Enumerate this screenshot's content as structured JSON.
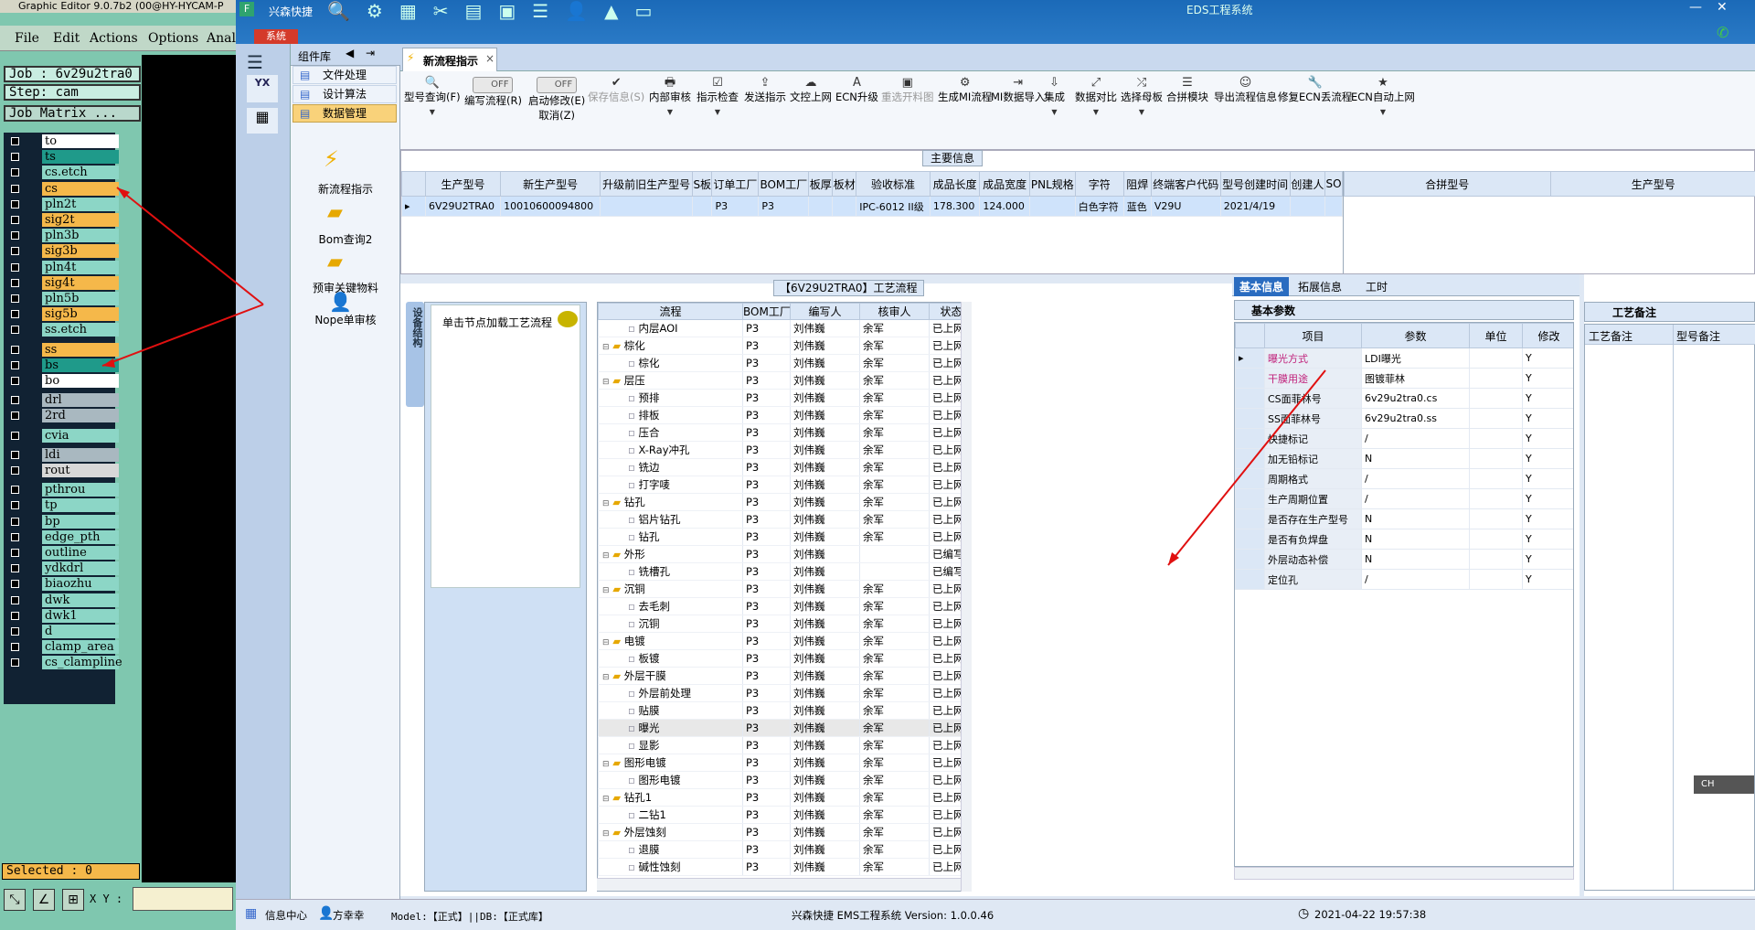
{
  "ge": {
    "title": "Graphic Editor 9.0.7b2 (00@HY-HYCAM-P",
    "menu": [
      "File",
      "Edit",
      "Actions",
      "Options",
      "Anal"
    ],
    "job": "Job : 6v29u2tra0",
    "step": "Step: cam",
    "matrix": "Job Matrix ...",
    "layers": [
      {
        "name": "to",
        "color": "#ffffff"
      },
      {
        "name": "ts",
        "color": "#1f9a8a"
      },
      {
        "name": "cs.etch",
        "color": "#8cd6c6"
      },
      {
        "name": "cs",
        "color": "#f5b84a"
      },
      {
        "name": "pln2t",
        "color": "#8cd6c6"
      },
      {
        "name": "sig2t",
        "color": "#f5b84a"
      },
      {
        "name": "pln3b",
        "color": "#8cd6c6"
      },
      {
        "name": "sig3b",
        "color": "#f5b84a"
      },
      {
        "name": "pln4t",
        "color": "#8cd6c6"
      },
      {
        "name": "sig4t",
        "color": "#f5b84a"
      },
      {
        "name": "pln5b",
        "color": "#8cd6c6"
      },
      {
        "name": "sig5b",
        "color": "#f5b84a"
      },
      {
        "name": "ss.etch",
        "color": "#8cd6c6"
      },
      {
        "name": "ss",
        "color": "#f5b84a"
      },
      {
        "name": "bs",
        "color": "#1f9a8a"
      },
      {
        "name": "bo",
        "color": "#ffffff"
      },
      {
        "name": "drl",
        "color": "#a9b8c0"
      },
      {
        "name": "2rd",
        "color": "#a9b8c0"
      },
      {
        "name": "cvia",
        "color": "#8cd6c6"
      },
      {
        "name": "ldi",
        "color": "#a9b8c0"
      },
      {
        "name": "rout",
        "color": "#d8d8d8"
      },
      {
        "name": "pthrou",
        "color": "#8cd6c6"
      },
      {
        "name": "tp",
        "color": "#8cd6c6"
      },
      {
        "name": "bp",
        "color": "#8cd6c6"
      },
      {
        "name": "edge_pth",
        "color": "#8cd6c6"
      },
      {
        "name": "outline",
        "color": "#8cd6c6"
      },
      {
        "name": "ydkdrl",
        "color": "#8cd6c6"
      },
      {
        "name": "biaozhu",
        "color": "#8cd6c6"
      },
      {
        "name": "dwk",
        "color": "#8cd6c6"
      },
      {
        "name": "dwk1",
        "color": "#8cd6c6"
      },
      {
        "name": "d",
        "color": "#8cd6c6"
      },
      {
        "name": "clamp_area",
        "color": "#8cd6c6"
      },
      {
        "name": "cs_clampline",
        "color": "#8cd6c6"
      }
    ],
    "selected": "Selected : 0",
    "xy_label": "X Y :"
  },
  "eds": {
    "app_title": "EDS工程系统",
    "sys_tab": "系统",
    "quick": "兴森快捷",
    "comp_lib": "组件库",
    "side_items": [
      "文件处理",
      "设计算法",
      "数据管理"
    ],
    "side_tools": [
      "新流程指示",
      "Bom查询2",
      "预审关键物料",
      "Nope单审核"
    ],
    "doc_tab": "新流程指示",
    "toolbar": [
      {
        "label": "型号查询(F)",
        "icon": "🔍",
        "arrow": true
      },
      {
        "label": "编写流程(R)",
        "toggle": "OFF"
      },
      {
        "label": "启动修改(E)",
        "toggle": "OFF",
        "label2": "取消(Z)"
      },
      {
        "label": "保存信息(S)",
        "icon": "✔",
        "dis": true
      },
      {
        "label": "内部审核",
        "icon": "🖶",
        "arrow": true
      },
      {
        "label": "指示检查",
        "icon": "☑",
        "arrow": true
      },
      {
        "label": "发送指示",
        "icon": "⇪"
      },
      {
        "label": "文控上网",
        "icon": "☁"
      },
      {
        "label": "ECN升级",
        "icon": "A"
      },
      {
        "label": "重选开料图",
        "icon": "▣",
        "dis": true
      },
      {
        "label": "生成MI流程",
        "icon": "⚙"
      },
      {
        "label": "MI数据导入",
        "icon": "⇥"
      },
      {
        "label": "集成",
        "icon": "⇩",
        "arrow": true
      },
      {
        "label": "数据对比",
        "icon": "⤢",
        "arrow": true
      },
      {
        "label": "选择母板",
        "icon": "⤮",
        "arrow": true
      },
      {
        "label": "合拼模块",
        "icon": "☰"
      },
      {
        "label": "导出流程信息",
        "icon": "☺"
      },
      {
        "label": "修复ECN丢流程",
        "icon": "🔧"
      },
      {
        "label": "ECN自动上网",
        "icon": "★",
        "arrow": true
      }
    ],
    "main_info_title": "主要信息",
    "main_headers": [
      "生产型号",
      "新生产型号",
      "升级前旧生产型号",
      "S板",
      "订单工厂",
      "BOM工厂",
      "板厚",
      "板材",
      "验收标准",
      "成品长度",
      "成品宽度",
      "PNL规格",
      "字符",
      "阻焊",
      "终端客户代码",
      "型号创建时间",
      "创建人",
      "SO"
    ],
    "main_row": [
      "6V29U2TRA0",
      "10010600094800",
      "",
      "",
      "P3",
      "P3",
      "",
      "",
      "IPC-6012 II级",
      "178.300",
      "124.000",
      "",
      "白色字符",
      "蓝色",
      "V29U",
      "2021/4/19",
      "",
      ""
    ],
    "merge_headers": [
      "合拼型号",
      "生产型号"
    ],
    "flow_title": "【6V29U2TRA0】工艺流程",
    "side_tab": "设备结构",
    "load_hint": "单击节点加载工艺流程",
    "flow_headers": [
      "流程",
      "BOM工厂",
      "编写人",
      "核审人",
      "状态"
    ],
    "flow_rows": [
      {
        "n": "内层AOI",
        "l": 2,
        "f": "P3",
        "w": "刘伟巍",
        "r": "余军",
        "s": "已上网"
      },
      {
        "n": "棕化",
        "l": 1,
        "f": "P3",
        "w": "刘伟巍",
        "r": "余军",
        "s": "已上网"
      },
      {
        "n": "棕化",
        "l": 2,
        "f": "P3",
        "w": "刘伟巍",
        "r": "余军",
        "s": "已上网"
      },
      {
        "n": "层压",
        "l": 1,
        "f": "P3",
        "w": "刘伟巍",
        "r": "余军",
        "s": "已上网"
      },
      {
        "n": "预排",
        "l": 2,
        "f": "P3",
        "w": "刘伟巍",
        "r": "余军",
        "s": "已上网"
      },
      {
        "n": "排板",
        "l": 2,
        "f": "P3",
        "w": "刘伟巍",
        "r": "余军",
        "s": "已上网"
      },
      {
        "n": "压合",
        "l": 2,
        "f": "P3",
        "w": "刘伟巍",
        "r": "余军",
        "s": "已上网"
      },
      {
        "n": "X-Ray冲孔",
        "l": 2,
        "f": "P3",
        "w": "刘伟巍",
        "r": "余军",
        "s": "已上网"
      },
      {
        "n": "铣边",
        "l": 2,
        "f": "P3",
        "w": "刘伟巍",
        "r": "余军",
        "s": "已上网"
      },
      {
        "n": "打字唛",
        "l": 2,
        "f": "P3",
        "w": "刘伟巍",
        "r": "余军",
        "s": "已上网"
      },
      {
        "n": "钻孔",
        "l": 1,
        "f": "P3",
        "w": "刘伟巍",
        "r": "余军",
        "s": "已上网"
      },
      {
        "n": "铝片钻孔",
        "l": 2,
        "f": "P3",
        "w": "刘伟巍",
        "r": "余军",
        "s": "已上网"
      },
      {
        "n": "钻孔",
        "l": 2,
        "f": "P3",
        "w": "刘伟巍",
        "r": "余军",
        "s": "已上网"
      },
      {
        "n": "外形",
        "l": 1,
        "f": "P3",
        "w": "刘伟巍",
        "r": "",
        "s": "已编写"
      },
      {
        "n": "铣槽孔",
        "l": 2,
        "f": "P3",
        "w": "刘伟巍",
        "r": "",
        "s": "已编写"
      },
      {
        "n": "沉铜",
        "l": 1,
        "f": "P3",
        "w": "刘伟巍",
        "r": "余军",
        "s": "已上网"
      },
      {
        "n": "去毛刺",
        "l": 2,
        "f": "P3",
        "w": "刘伟巍",
        "r": "余军",
        "s": "已上网"
      },
      {
        "n": "沉铜",
        "l": 2,
        "f": "P3",
        "w": "刘伟巍",
        "r": "余军",
        "s": "已上网"
      },
      {
        "n": "电镀",
        "l": 1,
        "f": "P3",
        "w": "刘伟巍",
        "r": "余军",
        "s": "已上网"
      },
      {
        "n": "板镀",
        "l": 2,
        "f": "P3",
        "w": "刘伟巍",
        "r": "余军",
        "s": "已上网"
      },
      {
        "n": "外层干膜",
        "l": 1,
        "f": "P3",
        "w": "刘伟巍",
        "r": "余军",
        "s": "已上网"
      },
      {
        "n": "外层前处理",
        "l": 2,
        "f": "P3",
        "w": "刘伟巍",
        "r": "余军",
        "s": "已上网"
      },
      {
        "n": "贴膜",
        "l": 2,
        "f": "P3",
        "w": "刘伟巍",
        "r": "余军",
        "s": "已上网"
      },
      {
        "n": "曝光",
        "l": 2,
        "f": "P3",
        "w": "刘伟巍",
        "r": "余军",
        "s": "已上网",
        "sel": true
      },
      {
        "n": "显影",
        "l": 2,
        "f": "P3",
        "w": "刘伟巍",
        "r": "余军",
        "s": "已上网"
      },
      {
        "n": "图形电镀",
        "l": 1,
        "f": "P3",
        "w": "刘伟巍",
        "r": "余军",
        "s": "已上网"
      },
      {
        "n": "图形电镀",
        "l": 2,
        "f": "P3",
        "w": "刘伟巍",
        "r": "余军",
        "s": "已上网"
      },
      {
        "n": "钻孔1",
        "l": 1,
        "f": "P3",
        "w": "刘伟巍",
        "r": "余军",
        "s": "已上网"
      },
      {
        "n": "二钻1",
        "l": 2,
        "f": "P3",
        "w": "刘伟巍",
        "r": "余军",
        "s": "已上网"
      },
      {
        "n": "外层蚀刻",
        "l": 1,
        "f": "P3",
        "w": "刘伟巍",
        "r": "余军",
        "s": "已上网"
      },
      {
        "n": "退膜",
        "l": 2,
        "f": "P3",
        "w": "刘伟巍",
        "r": "余军",
        "s": "已上网"
      },
      {
        "n": "碱性蚀刻",
        "l": 2,
        "f": "P3",
        "w": "刘伟巍",
        "r": "余军",
        "s": "已上网"
      }
    ],
    "basic_tabs": [
      "基本信息",
      "拓展信息",
      "工时"
    ],
    "basic_params": "基本参数",
    "basic_headers": [
      "项目",
      "参数",
      "单位",
      "修改"
    ],
    "basic_rows": [
      {
        "k": "曝光方式",
        "v": "LDI曝光",
        "m": "Y",
        "c": "#c0207a"
      },
      {
        "k": "干膜用途",
        "v": "图镀菲林",
        "m": "Y",
        "c": "#c0207a"
      },
      {
        "k": "CS面菲林号",
        "v": "6v29u2tra0.cs",
        "m": "Y"
      },
      {
        "k": "SS面菲林号",
        "v": "6v29u2tra0.ss",
        "m": "Y"
      },
      {
        "k": "快捷标记",
        "v": "/",
        "m": "Y"
      },
      {
        "k": "加无铅标记",
        "v": "N",
        "m": "Y"
      },
      {
        "k": "周期格式",
        "v": "/",
        "m": "Y"
      },
      {
        "k": "生产周期位置",
        "v": "/",
        "m": "Y"
      },
      {
        "k": "是否存在生产型号",
        "v": "N",
        "m": "Y"
      },
      {
        "k": "是否有负焊盘",
        "v": "N",
        "m": "Y"
      },
      {
        "k": "外层动态补偿",
        "v": "N",
        "m": "Y"
      },
      {
        "k": "定位孔",
        "v": "/",
        "m": "Y"
      }
    ],
    "notes_title": "工艺备注",
    "notes_headers": [
      "工艺备注",
      "型号备注"
    ],
    "status": {
      "info": "信息中心",
      "user": "方幸幸",
      "model": "Model:【正式】||DB:【正式库】",
      "version": "兴森快捷 EMS工程系统 Version: 1.0.0.46",
      "time": "2021-04-22 19:57:38"
    },
    "ime": "CH"
  }
}
